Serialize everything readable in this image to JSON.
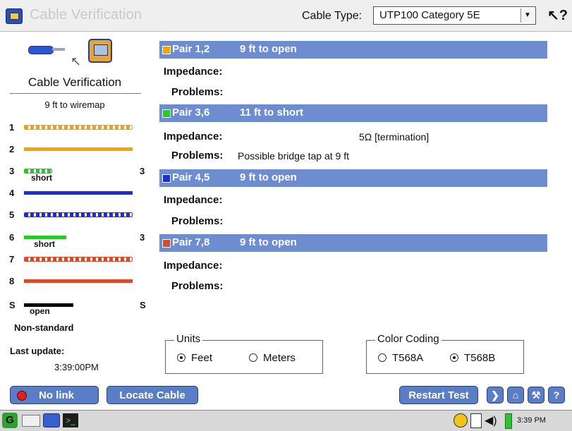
{
  "window": {
    "title": "Cable Verification",
    "cable_type_label": "Cable Type:",
    "cable_type_value": "UTP100 Category 5E",
    "help_icon": "help-cursor-icon"
  },
  "left_panel": {
    "title": "Cable Verification",
    "wiremap_title": "9 ft to wiremap",
    "wires": [
      {
        "pin": "1",
        "color": "#f0a500",
        "style": "striped"
      },
      {
        "pin": "2",
        "color": "#f0a500",
        "style": "solid"
      },
      {
        "pin": "3",
        "color": "#22cc22",
        "style": "striped",
        "label": "short",
        "end": "3"
      },
      {
        "pin": "4",
        "color": "#1a2fd6",
        "style": "solid"
      },
      {
        "pin": "5",
        "color": "#1a2fd6",
        "style": "striped"
      },
      {
        "pin": "6",
        "color": "#22cc22",
        "style": "solid",
        "label": "short",
        "end": "3"
      },
      {
        "pin": "7",
        "color": "#d84a2a",
        "style": "striped"
      },
      {
        "pin": "8",
        "color": "#d84a2a",
        "style": "solid"
      },
      {
        "pin": "S",
        "color": "#000000",
        "style": "solid",
        "label": "open",
        "end": "S"
      }
    ],
    "non_standard": "Non-standard",
    "last_update_label": "Last update:",
    "last_update_time": "3:39:00PM"
  },
  "pairs": [
    {
      "name": "Pair 1,2",
      "status": "9 ft to open",
      "color": "#f0a500",
      "impedance_label": "Impedance:",
      "impedance_value": "",
      "problems_label": "Problems:",
      "problems_value": ""
    },
    {
      "name": "Pair 3,6",
      "status": "11 ft to short",
      "color": "#22cc22",
      "impedance_label": "Impedance:",
      "impedance_value": "5Ω [termination]",
      "problems_label": "Problems:",
      "problems_value": "Possible bridge tap at 9 ft"
    },
    {
      "name": "Pair 4,5",
      "status": "9 ft to open",
      "color": "#1a2fd6",
      "impedance_label": "Impedance:",
      "impedance_value": "",
      "problems_label": "Problems:",
      "problems_value": ""
    },
    {
      "name": "Pair 7,8",
      "status": "9 ft to open",
      "color": "#d84a2a",
      "impedance_label": "Impedance:",
      "impedance_value": "",
      "problems_label": "Problems:",
      "problems_value": ""
    }
  ],
  "units": {
    "legend": "Units",
    "options": [
      "Feet",
      "Meters"
    ],
    "selected": "Feet"
  },
  "color_coding": {
    "legend": "Color Coding",
    "options": [
      "T568A",
      "T568B"
    ],
    "selected": "T568B"
  },
  "actions": {
    "no_link": "No link",
    "locate_cable": "Locate Cable",
    "restart_test": "Restart Test",
    "icons": [
      "arrow-right-icon",
      "home-icon",
      "wrench-icon",
      "question-icon"
    ]
  },
  "taskbar": {
    "clock": "3:39 PM"
  },
  "colors": {
    "accent": "#6e8dd1",
    "button": "#5a7ec6"
  }
}
